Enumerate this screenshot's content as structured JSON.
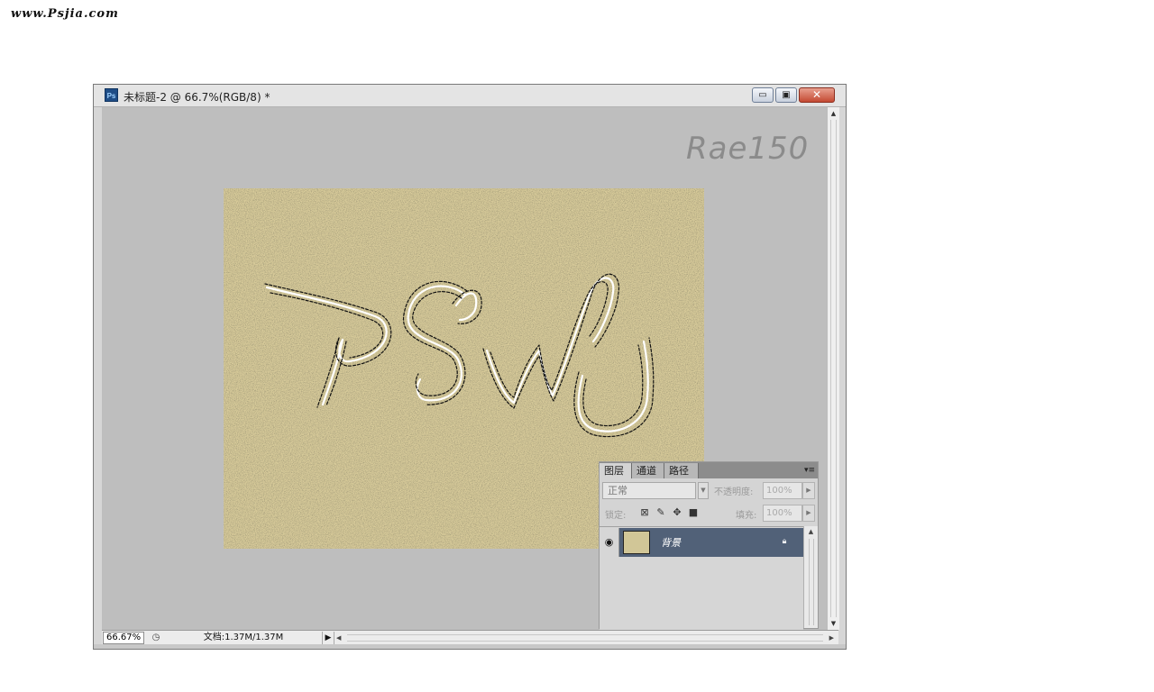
{
  "site": {
    "watermark": "www.Psjia.com"
  },
  "window": {
    "app_icon": "Ps",
    "title": "未标题-2 @ 66.7%(RGB/8) *",
    "min_glyph": "▭",
    "max_glyph": "▣",
    "close_glyph": "✕"
  },
  "canvas": {
    "overlay_text": "Rae150",
    "sand_color": "#d8cb9a",
    "selection_text": "PSWC"
  },
  "status": {
    "zoom": "66.67%",
    "doc_info": "文档:1.37M/1.37M",
    "menu_arrow": "▶"
  },
  "layers_panel": {
    "tabs": [
      "图层",
      "通道",
      "路径"
    ],
    "menu": "▾≡",
    "blend_mode": "正常",
    "opacity_label": "不透明度:",
    "opacity_value": "100%",
    "lock_label": "锁定:",
    "lock_icons": [
      "transparency-lock-icon",
      "brush-lock-icon",
      "move-lock-icon",
      "padlock-icon"
    ],
    "fill_label": "填充:",
    "fill_value": "100%",
    "layers": [
      {
        "name": "背景",
        "visible": true,
        "locked": true
      }
    ]
  }
}
